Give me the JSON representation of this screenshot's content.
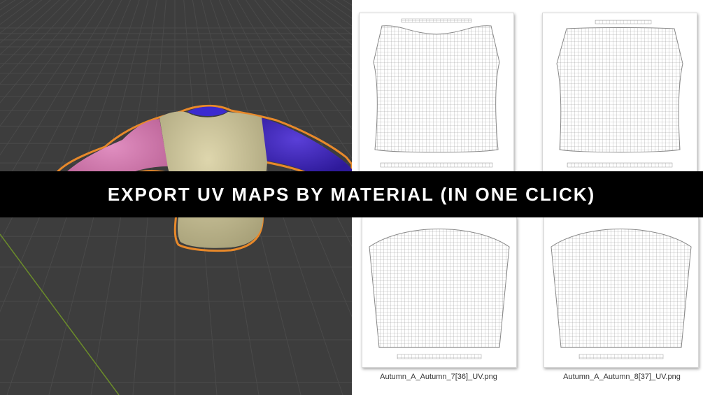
{
  "banner": {
    "title": "EXPORT UV MAPS BY MATERIAL (IN ONE CLICK)"
  },
  "viewport": {
    "background": "#3d3d3d",
    "grid_color": "#4a4a4a",
    "y_axis_color": "#6b8c2a",
    "selection_outline_color": "#e8892a",
    "materials": [
      {
        "name": "torso",
        "color": "#cfc69b"
      },
      {
        "name": "left-sleeve",
        "color": "#d97bb0"
      },
      {
        "name": "right-sleeve",
        "color": "#4a2fc0"
      },
      {
        "name": "collar",
        "color": "#3b2ad0"
      }
    ]
  },
  "gallery": {
    "uv_line_color": "#9a9a9a",
    "files": [
      {
        "name": ""
      },
      {
        "name": ""
      },
      {
        "name": "Autumn_A_Autumn_7[36]_UV.png"
      },
      {
        "name": "Autumn_A_Autumn_8[37]_UV.png"
      }
    ]
  }
}
